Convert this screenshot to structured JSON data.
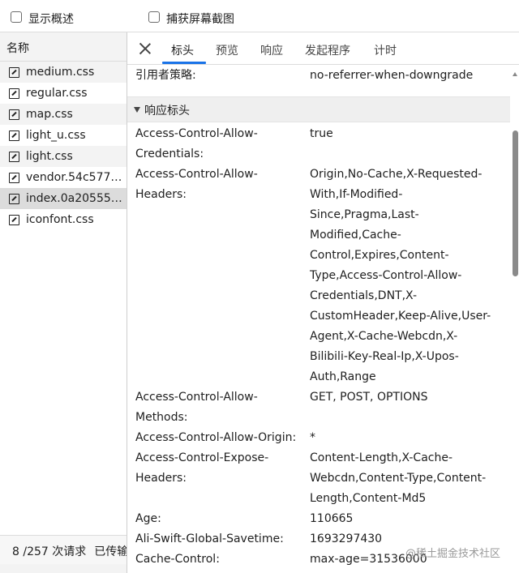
{
  "topbar": {
    "show_overview_label": "显示概述",
    "capture_screenshot_label": "捕获屏幕截图"
  },
  "left": {
    "header": "名称",
    "files": [
      {
        "name": "medium.css"
      },
      {
        "name": "regular.css"
      },
      {
        "name": "map.css"
      },
      {
        "name": "light_u.css"
      },
      {
        "name": "light.css"
      },
      {
        "name": "vendor.54c577a..."
      },
      {
        "name": "index.0a20555e...."
      },
      {
        "name": "iconfont.css"
      }
    ],
    "footer_requests": "8 /257 次请求",
    "footer_transferred": "已传输"
  },
  "tabs": [
    "标头",
    "预览",
    "响应",
    "发起程序",
    "计时"
  ],
  "active_tab": "标头",
  "referrer": {
    "key": "引用者策略:",
    "value": "no-referrer-when-downgrade"
  },
  "section_title": "响应标头",
  "headers": [
    {
      "key": [
        "Access-Control-Allow-",
        "Credentials:"
      ],
      "value": [
        "true"
      ]
    },
    {
      "key": [
        "Access-Control-Allow-",
        "Headers:"
      ],
      "value": [
        "Origin,No-Cache,X-Requested-",
        "With,If-Modified-",
        "Since,Pragma,Last-",
        "Modified,Cache-",
        "Control,Expires,Content-",
        "Type,Access-Control-Allow-",
        "Credentials,DNT,X-",
        "CustomHeader,Keep-Alive,User-",
        "Agent,X-Cache-Webcdn,X-",
        "Bilibili-Key-Real-Ip,X-Upos-",
        "Auth,Range"
      ]
    },
    {
      "key": [
        "Access-Control-Allow-",
        "Methods:"
      ],
      "value": [
        "GET, POST, OPTIONS"
      ]
    },
    {
      "key": [
        "Access-Control-Allow-Origin:"
      ],
      "value": [
        "*"
      ]
    },
    {
      "key": [
        "Access-Control-Expose-",
        "Headers:"
      ],
      "value": [
        "Content-Length,X-Cache-",
        "Webcdn,Content-Type,Content-",
        "Length,Content-Md5"
      ]
    },
    {
      "key": [
        "Age:"
      ],
      "value": [
        "110665"
      ]
    },
    {
      "key": [
        "Ali-Swift-Global-Savetime:"
      ],
      "value": [
        "1693297430"
      ]
    },
    {
      "key": [
        "Cache-Control:"
      ],
      "value": [
        "max-age=31536000"
      ]
    }
  ],
  "watermark": "@稀土掘金技术社区"
}
